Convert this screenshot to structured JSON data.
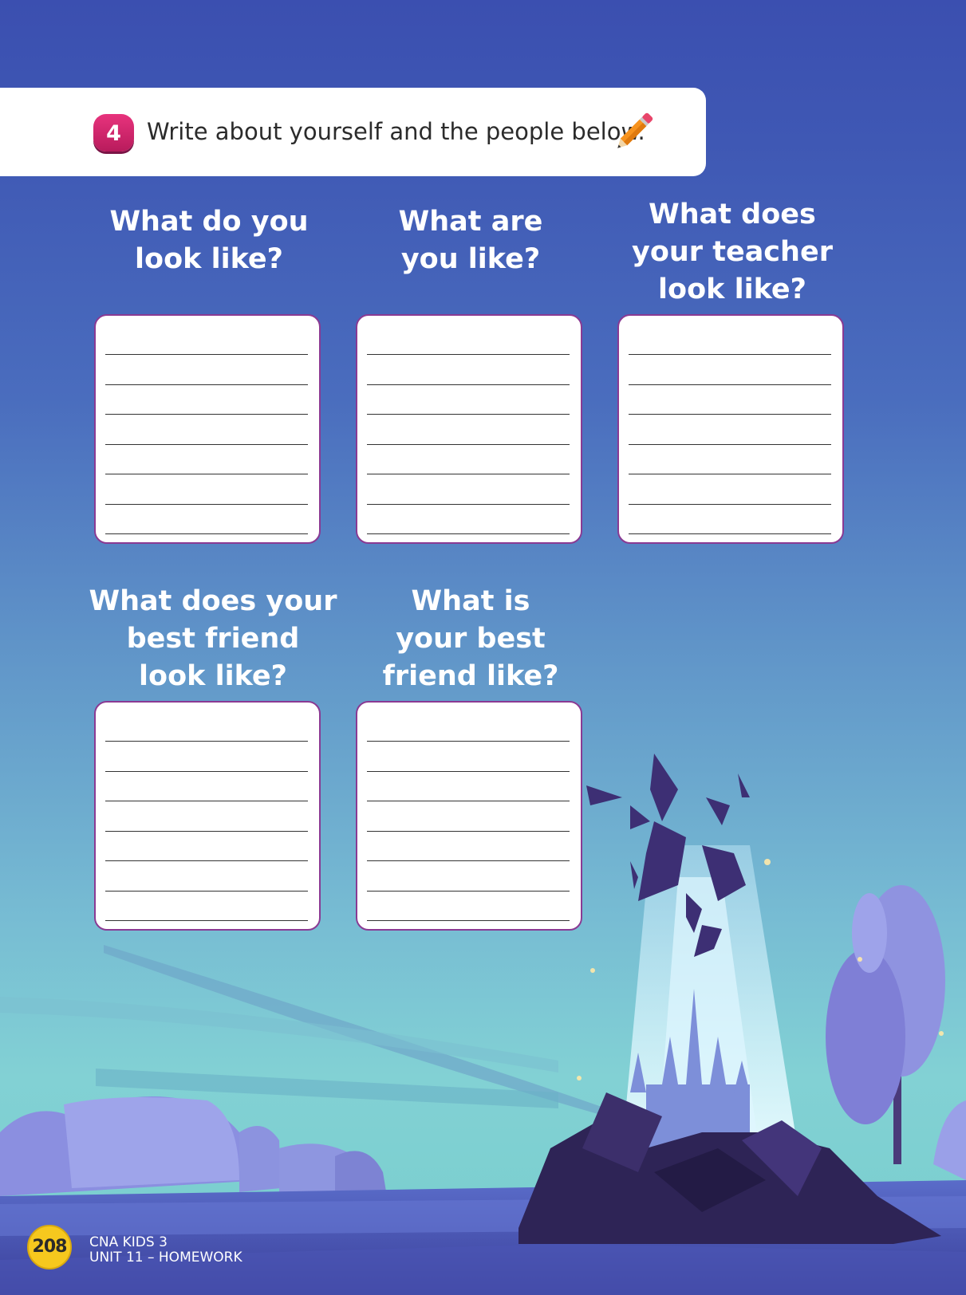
{
  "exercise": {
    "number": "4",
    "instruction": "Write about yourself and the people below."
  },
  "questions": [
    {
      "line1": "What do you",
      "line2": "look like?",
      "line3": ""
    },
    {
      "line1": "What are",
      "line2": "you like?",
      "line3": ""
    },
    {
      "line1": "What does",
      "line2": "your teacher",
      "line3": "look like?"
    },
    {
      "line1": "What does your",
      "line2": "best friend",
      "line3": "look like?"
    },
    {
      "line1": "What is",
      "line2": "your best",
      "line3": "friend like?"
    }
  ],
  "footer": {
    "page_number": "208",
    "book_title": "CNA KIDS 3",
    "unit": "UNIT 11 – HOMEWORK"
  },
  "colors": {
    "background_top": "#3b4fb0",
    "background_bottom": "#82d1d4",
    "badge": "#e8337d",
    "box_border": "#8a3a93",
    "page_badge": "#f6c81e"
  },
  "icons": [
    "pencil-icon"
  ]
}
